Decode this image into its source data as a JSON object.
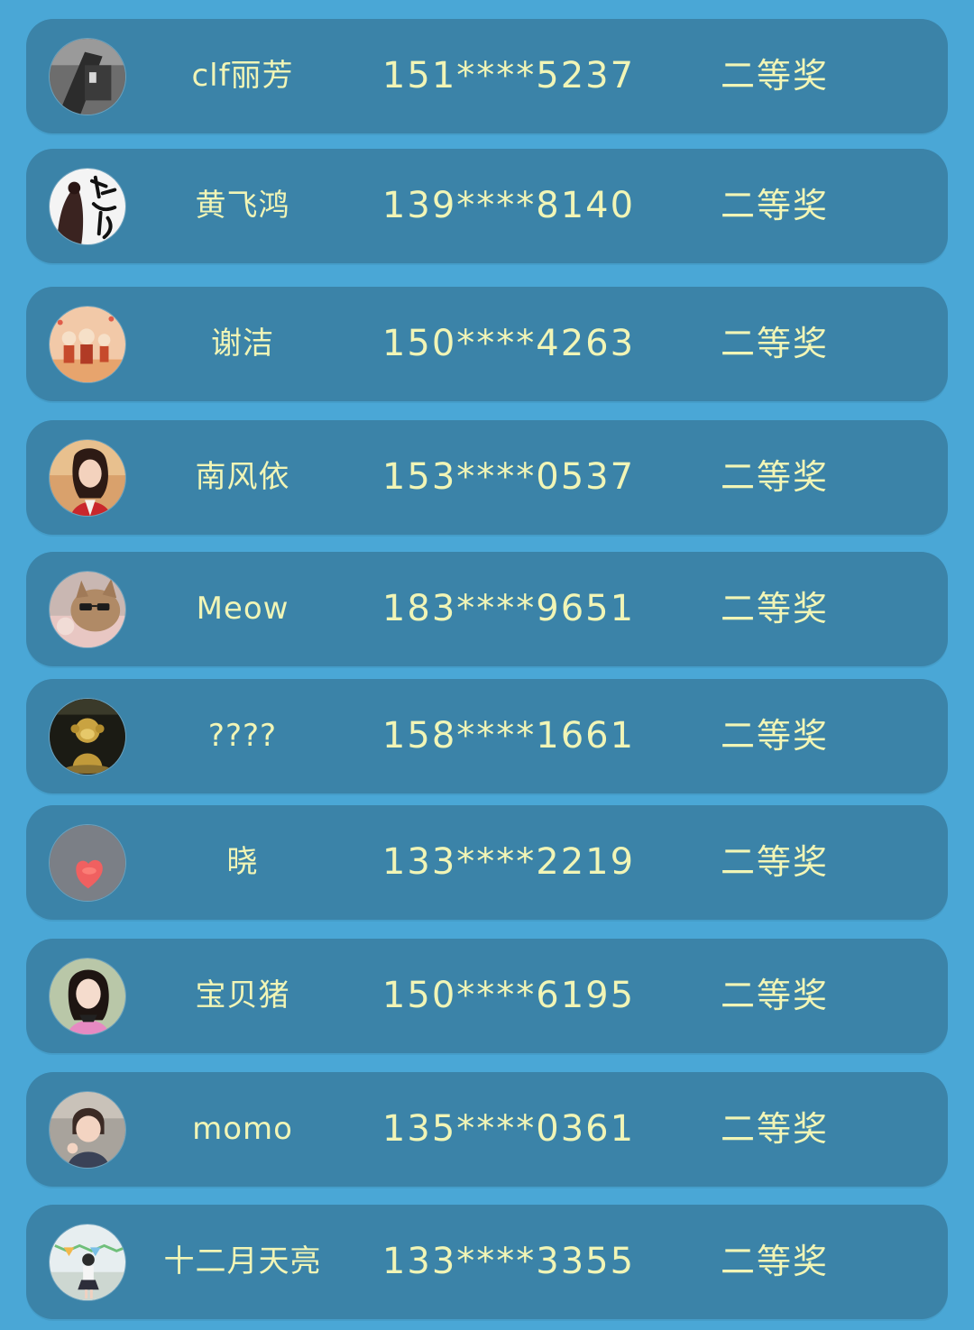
{
  "winners": [
    {
      "name": "clf丽芳",
      "phone": "151****5237",
      "prize": "二等奖",
      "avatar_icon": "photo-avatar-icon"
    },
    {
      "name": "黄飞鸿",
      "phone": "139****8140",
      "prize": "二等奖",
      "avatar_icon": "calligraphy-avatar-icon"
    },
    {
      "name": "谢洁",
      "phone": "150****4263",
      "prize": "二等奖",
      "avatar_icon": "family-avatar-icon"
    },
    {
      "name": "南风依",
      "phone": "153****0537",
      "prize": "二等奖",
      "avatar_icon": "portrait-avatar-icon"
    },
    {
      "name": "Meow",
      "phone": "183****9651",
      "prize": "二等奖",
      "avatar_icon": "cat-avatar-icon"
    },
    {
      "name": "????",
      "phone": "158****1661",
      "prize": "二等奖",
      "avatar_icon": "monkey-avatar-icon"
    },
    {
      "name": "晓",
      "phone": "133****2219",
      "prize": "二等奖",
      "avatar_icon": "heart-avatar-icon"
    },
    {
      "name": "宝贝猪",
      "phone": "150****6195",
      "prize": "二等奖",
      "avatar_icon": "portrait-avatar-icon"
    },
    {
      "name": "momo",
      "phone": "135****0361",
      "prize": "二等奖",
      "avatar_icon": "child-avatar-icon"
    },
    {
      "name": "十二月天亮",
      "phone": "133****3355",
      "prize": "二等奖",
      "avatar_icon": "photo-avatar-icon"
    }
  ],
  "colors": {
    "background": "#4aa7d6",
    "row": "#3b83a8",
    "text": "#f1f5b6"
  }
}
